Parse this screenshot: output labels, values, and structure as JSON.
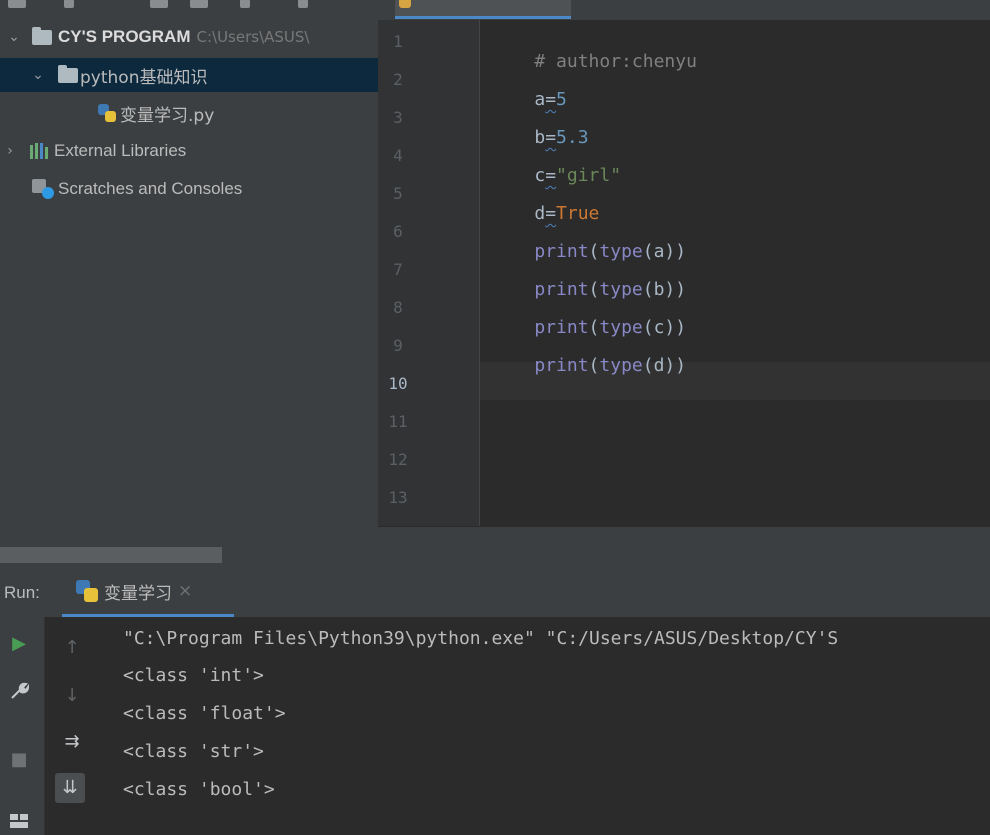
{
  "project_panel": {
    "root": {
      "name": "CY'S PROGRAM",
      "path": "C:\\Users\\ASUS\\"
    },
    "folder": {
      "name": "python基础知识"
    },
    "file": {
      "name": "变量学习.py"
    },
    "external_libraries": "External Libraries",
    "scratches": "Scratches and Consoles"
  },
  "editor": {
    "line_numbers": [
      "1",
      "2",
      "3",
      "4",
      "5",
      "6",
      "7",
      "8",
      "9",
      "10",
      "11",
      "12",
      "13"
    ],
    "current_line": "10",
    "code": {
      "l1": {
        "comment": "# author:chenyu"
      },
      "l2": {
        "var": "a",
        "op": "=",
        "val": "5"
      },
      "l3": {
        "var": "b",
        "op": "=",
        "val": "5.3"
      },
      "l4": {
        "var": "c",
        "op": "=",
        "val": "\"girl\""
      },
      "l5": {
        "var": "d",
        "op": "=",
        "val": "True"
      },
      "l6": {
        "fn": "print",
        "open": "(",
        "inner": "type",
        "arg": "(a))"
      },
      "l7": {
        "fn": "print",
        "open": "(",
        "inner": "type",
        "arg": "(b))"
      },
      "l8": {
        "fn": "print",
        "open": "(",
        "inner": "type",
        "arg": "(c))"
      },
      "l9": {
        "fn": "print",
        "open": "(",
        "inner": "type",
        "arg": "(d))"
      }
    }
  },
  "run_panel": {
    "label": "Run:",
    "tab": "变量学习",
    "close": "×",
    "output": [
      "\"C:\\Program Files\\Python39\\python.exe\" \"C:/Users/ASUS/Desktop/CY'S",
      "<class 'int'>",
      "<class 'float'>",
      "<class 'str'>",
      "<class 'bool'>"
    ]
  },
  "icons": {
    "chevron_down": "⌄",
    "chevron_right": "›",
    "run": "▶",
    "wrench": "🔧",
    "stop": "■",
    "up_arrow": "↑",
    "down_arrow": "↓",
    "soft_wrap": "⇉",
    "scroll_end": "⇊"
  },
  "colors": {
    "accent": "#4a88c7",
    "keyword": "#cc7832",
    "string": "#6a8759",
    "number": "#6897bb",
    "builtin": "#8888c6",
    "comment": "#808080",
    "run_green": "#499c54"
  }
}
